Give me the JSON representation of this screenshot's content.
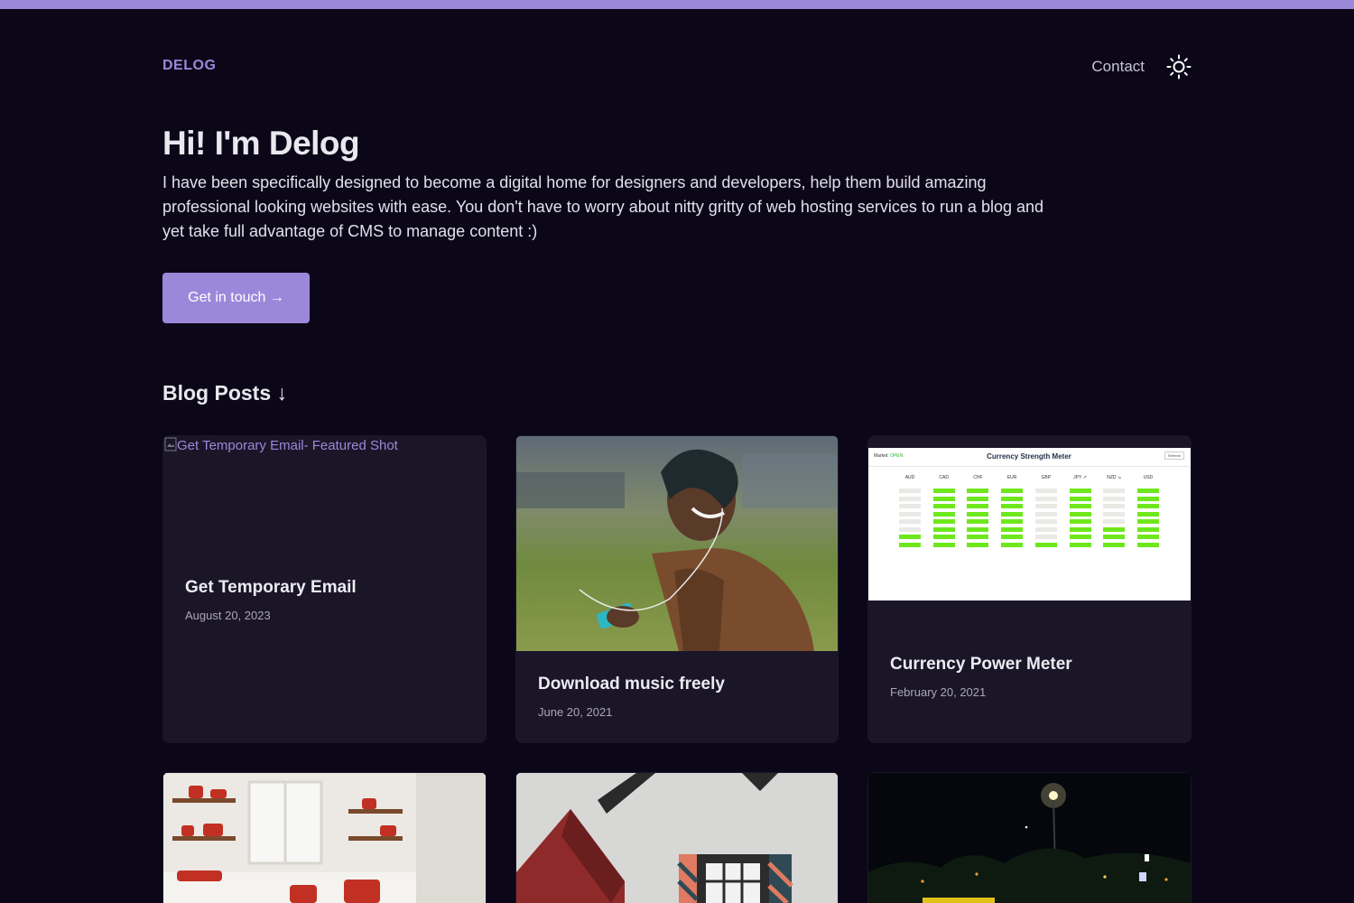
{
  "site": {
    "logo": "DELOG",
    "nav": {
      "contact": "Contact"
    },
    "theme_icon": "sun-icon"
  },
  "hero": {
    "title": "Hi! I'm Delog",
    "text": "I have been specifically designed to become a digital home for designers and developers, help them build amazing professional looking websites with ease. You don't have to worry about nitty gritty of web hosting services to run a blog and yet take full advantage of CMS to manage content :)",
    "cta": "Get in touch →"
  },
  "blog": {
    "heading": "Blog Posts ↓",
    "posts": [
      {
        "title": "Get Temporary Email",
        "date": "August 20, 2023",
        "image_alt": "Get Temporary Email- Featured Shot"
      },
      {
        "title": "Download music freely",
        "date": "June 20, 2021"
      },
      {
        "title": "Currency Power Meter",
        "date": "February 20, 2021"
      }
    ]
  },
  "currency_meter": {
    "title": "Currency Strength Meter",
    "status_label": "Market:",
    "status_value": "OPEN",
    "refresh": "Refresh",
    "currencies": [
      "AUD",
      "CAD",
      "CHF",
      "EUR",
      "GBP",
      "JPY ↗",
      "NZD ↘",
      "USD"
    ],
    "strength": [
      2,
      8,
      8,
      8,
      1,
      8,
      3,
      8
    ],
    "max": 8
  },
  "colors": {
    "accent": "#9c88da",
    "background": "#0b0719",
    "card": "#1a1628"
  }
}
